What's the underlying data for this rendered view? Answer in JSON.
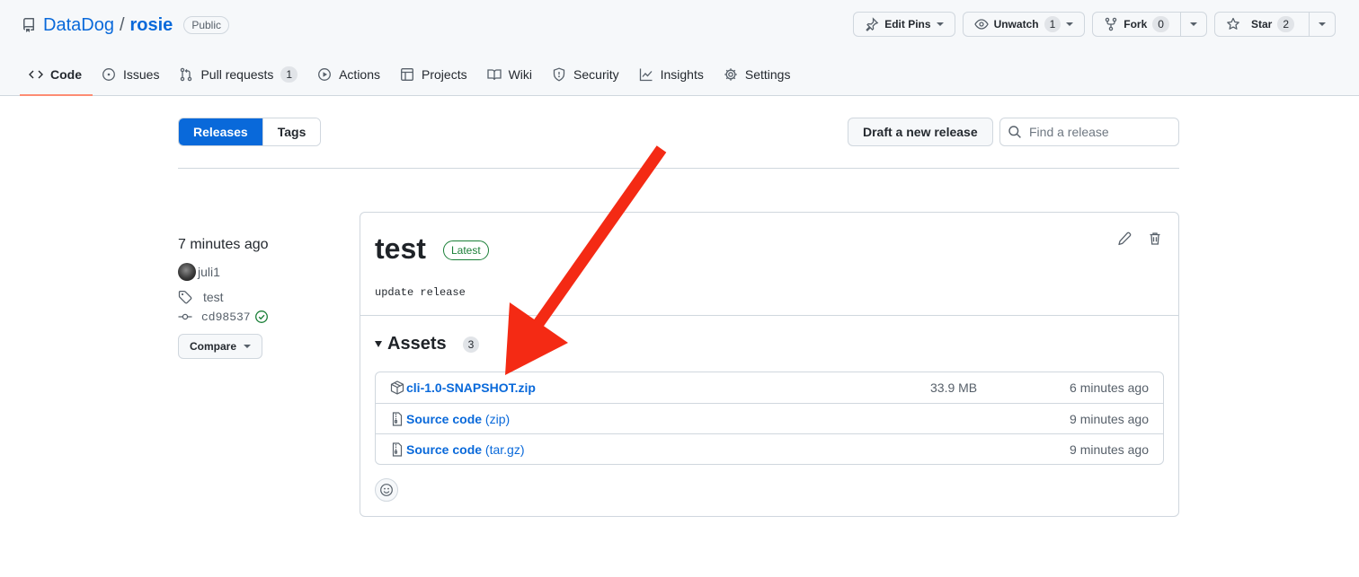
{
  "repo": {
    "owner": "DataDog",
    "separator": "/",
    "name": "rosie",
    "visibility": "Public"
  },
  "header_actions": {
    "edit_pins": "Edit Pins",
    "unwatch": "Unwatch",
    "unwatch_count": "1",
    "fork": "Fork",
    "fork_count": "0",
    "star": "Star",
    "star_count": "2"
  },
  "nav": {
    "code": "Code",
    "issues": "Issues",
    "pull_requests": "Pull requests",
    "pull_requests_count": "1",
    "actions": "Actions",
    "projects": "Projects",
    "wiki": "Wiki",
    "security": "Security",
    "insights": "Insights",
    "settings": "Settings"
  },
  "toolbar": {
    "releases_tab": "Releases",
    "tags_tab": "Tags",
    "draft_button": "Draft a new release",
    "search_placeholder": "Find a release"
  },
  "release": {
    "time_ago": "7 minutes ago",
    "author": "juli1",
    "tag": "test",
    "commit": "cd98537",
    "compare_label": "Compare",
    "title": "test",
    "latest_badge": "Latest",
    "body": "update release",
    "assets_label": "Assets",
    "assets_count": "3",
    "assets": [
      {
        "name": "cli-1.0-SNAPSHOT.zip",
        "suffix": "",
        "size": "33.9 MB",
        "time": "6 minutes ago",
        "icon": "package-icon"
      },
      {
        "name": "Source code",
        "suffix": " (zip)",
        "size": "",
        "time": "9 minutes ago",
        "icon": "file-zip-icon"
      },
      {
        "name": "Source code",
        "suffix": " (tar.gz)",
        "size": "",
        "time": "9 minutes ago",
        "icon": "file-zip-icon"
      }
    ]
  },
  "colors": {
    "accent": "#0969da",
    "success": "#1a7f37",
    "nav_underline": "#fd8c73",
    "annotation_arrow": "#f42a14"
  }
}
